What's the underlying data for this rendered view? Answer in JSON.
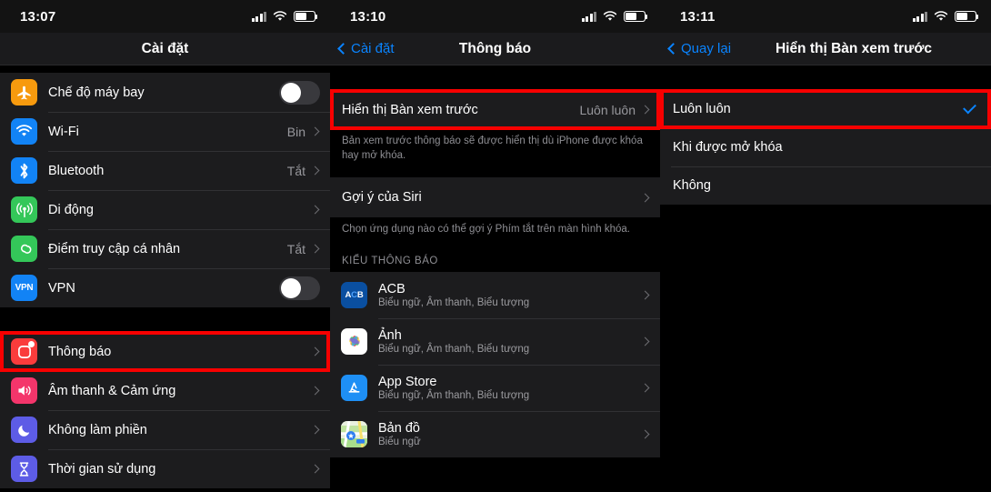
{
  "panels": [
    {
      "id": "settings",
      "status": {
        "time": "13:07"
      },
      "nav": {
        "title": "Cài đặt",
        "back": null
      },
      "groups": [
        {
          "rows": [
            {
              "label": "Chế độ máy bay",
              "icon": "airplane-icon",
              "accessory": "toggle",
              "value": ""
            },
            {
              "label": "Wi-Fi",
              "icon": "wifi-icon",
              "accessory": "chevron",
              "value": "Bin"
            },
            {
              "label": "Bluetooth",
              "icon": "bluetooth-icon",
              "accessory": "chevron",
              "value": "Tắt"
            },
            {
              "label": "Di động",
              "icon": "cellular-icon",
              "accessory": "chevron",
              "value": ""
            },
            {
              "label": "Điểm truy cập cá nhân",
              "icon": "hotspot-icon",
              "accessory": "chevron",
              "value": "Tắt"
            },
            {
              "label": "VPN",
              "icon": "vpn-icon",
              "accessory": "toggle",
              "value": ""
            }
          ]
        },
        {
          "rows": [
            {
              "label": "Thông báo",
              "icon": "notifications-icon",
              "accessory": "chevron",
              "value": "",
              "highlighted": true
            },
            {
              "label": "Âm thanh & Cảm ứng",
              "icon": "sounds-icon",
              "accessory": "chevron",
              "value": ""
            },
            {
              "label": "Không làm phiền",
              "icon": "moon-icon",
              "accessory": "chevron",
              "value": ""
            },
            {
              "label": "Thời gian sử dụng",
              "icon": "hourglass-icon",
              "accessory": "chevron",
              "value": ""
            }
          ]
        }
      ]
    },
    {
      "id": "notifications",
      "status": {
        "time": "13:10"
      },
      "nav": {
        "title": "Thông báo",
        "back": "Cài đặt"
      },
      "show_previews": {
        "label": "Hiển thị Bàn xem trước",
        "value": "Luôn luôn",
        "highlighted": true
      },
      "show_previews_note": "Bản xem trước thông báo sẽ được hiển thị dù iPhone được khóa hay mở khóa.",
      "siri": {
        "label": "Gợi ý của Siri"
      },
      "siri_note": "Chọn ứng dụng nào có thể gợi ý Phím tắt trên màn hình khóa.",
      "section_header": "KIỂU THÔNG BÁO",
      "apps": [
        {
          "name": "ACB",
          "sub": "Biểu ngữ, Âm thanh, Biểu tượng",
          "icon": "acb-app-icon"
        },
        {
          "name": "Ảnh",
          "sub": "Biểu ngữ, Âm thanh, Biểu tượng",
          "icon": "photos-app-icon"
        },
        {
          "name": "App Store",
          "sub": "Biểu ngữ, Âm thanh, Biểu tượng",
          "icon": "appstore-app-icon"
        },
        {
          "name": "Bản đồ",
          "sub": "Biểu ngữ",
          "icon": "maps-app-icon"
        }
      ]
    },
    {
      "id": "previews",
      "status": {
        "time": "13:11"
      },
      "nav": {
        "title": "Hiển thị Bàn xem trước",
        "back": "Quay lại"
      },
      "options": [
        {
          "label": "Luôn luôn",
          "selected": true,
          "highlighted": true
        },
        {
          "label": "Khi được mở khóa",
          "selected": false,
          "highlighted": false
        },
        {
          "label": "Không",
          "selected": false,
          "highlighted": false
        }
      ]
    }
  ],
  "colors": {
    "highlight": "#f70000",
    "accent": "#0a84ff",
    "row_bg": "#1c1c1e",
    "page_bg": "#000000",
    "secondary_text": "#8e8e93"
  }
}
